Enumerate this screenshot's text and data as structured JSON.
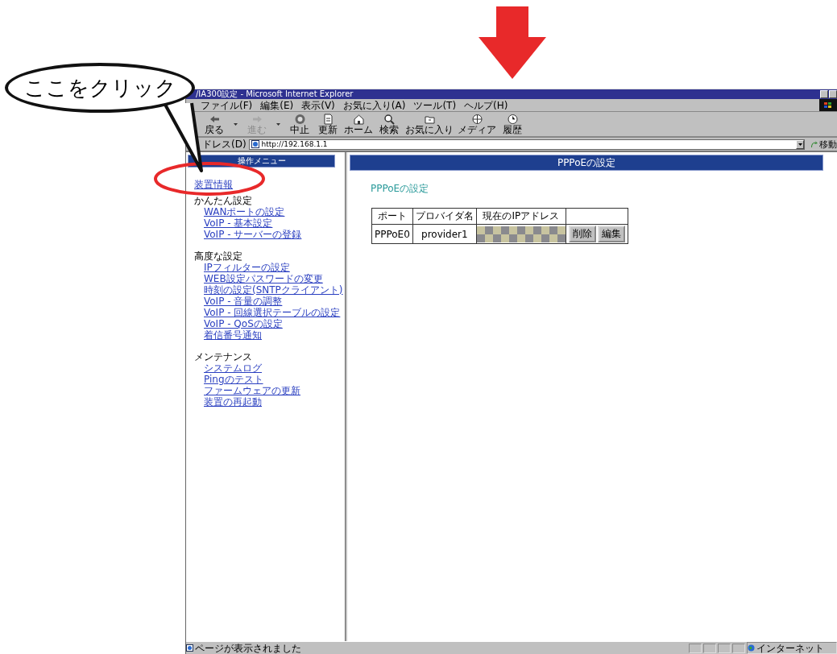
{
  "callout": {
    "text": "ここをクリック"
  },
  "window": {
    "title": "/IA300設定 - Microsoft Internet Explorer",
    "menu": [
      "ファイル(F)",
      "編集(E)",
      "表示(V)",
      "お気に入り(A)",
      "ツール(T)",
      "ヘルプ(H)"
    ],
    "toolbar": [
      {
        "label": "戻る",
        "disabled": false,
        "has_dropdown": true
      },
      {
        "label": "進む",
        "disabled": true,
        "has_dropdown": true
      },
      {
        "label": "中止",
        "disabled": false,
        "has_dropdown": false
      },
      {
        "label": "更新",
        "disabled": false,
        "has_dropdown": false
      },
      {
        "label": "ホーム",
        "disabled": false,
        "has_dropdown": false
      },
      {
        "label": "検索",
        "disabled": false,
        "has_dropdown": false
      },
      {
        "label": "お気に入り",
        "disabled": false,
        "has_dropdown": false
      },
      {
        "label": "メディア",
        "disabled": false,
        "has_dropdown": false
      },
      {
        "label": "履歴",
        "disabled": false,
        "has_dropdown": false
      }
    ],
    "address": {
      "label": "ドレス(D)",
      "value": "http://192.168.1.1",
      "go": "移動"
    }
  },
  "sidebar": {
    "title": "操作メニュー",
    "top_link": "装置情報",
    "sections": [
      {
        "heading": "かんたん設定",
        "links": [
          "WANポートの設定",
          "VoIP - 基本設定",
          "VoIP - サーバーの登録"
        ]
      },
      {
        "heading": "高度な設定",
        "links": [
          "IPフィルターの設定",
          "WEB設定パスワードの変更",
          "時刻の設定(SNTPクライアント)",
          "VoIP - 音量の調整",
          "VoIP - 回線選択テーブルの設定",
          "VoIP - QoSの設定",
          "着信番号通知"
        ]
      },
      {
        "heading": "メンテナンス",
        "links": [
          "システムログ",
          "Pingのテスト",
          "ファームウェアの更新",
          "装置の再起動"
        ]
      }
    ]
  },
  "main": {
    "title": "PPPoEの設定",
    "heading": "PPPoEの設定",
    "table": {
      "columns": [
        "ポート",
        "プロバイダ名",
        "現在のIPアドレス"
      ],
      "rows": [
        {
          "port": "PPPoE0",
          "provider": "provider1",
          "ip_masked": true,
          "actions": [
            "削除",
            "編集"
          ]
        }
      ]
    }
  },
  "status_bar": {
    "message": "ページが表示されました",
    "zone": "インターネット"
  }
}
